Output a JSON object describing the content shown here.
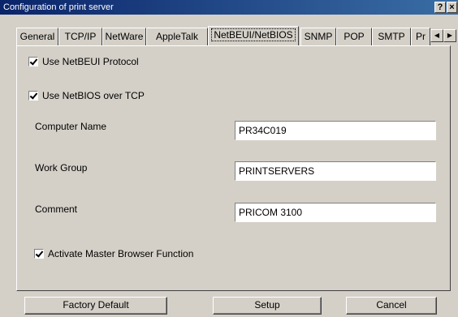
{
  "window": {
    "title": "Configuration of print server",
    "help_glyph": "?",
    "close_glyph": "×"
  },
  "tabs": [
    {
      "label": "General"
    },
    {
      "label": "TCP/IP"
    },
    {
      "label": "NetWare"
    },
    {
      "label": "AppleTalk"
    },
    {
      "label": "NetBEUI/NetBIOS",
      "active": true
    },
    {
      "label": "SNMP"
    },
    {
      "label": "POP"
    },
    {
      "label": "SMTP"
    },
    {
      "label": "Pr"
    }
  ],
  "tab_scroll": {
    "left_glyph": "◀",
    "right_glyph": "▶"
  },
  "panel": {
    "use_netbeui": {
      "label": "Use NetBEUI Protocol",
      "checked": true
    },
    "use_netbios": {
      "label": "Use NetBIOS over TCP",
      "checked": true
    },
    "computer_name": {
      "label": "Computer Name",
      "value": "PR34C019"
    },
    "work_group": {
      "label": "Work Group",
      "value": "PRINTSERVERS"
    },
    "comment": {
      "label": "Comment",
      "value": "PRICOM 3100"
    },
    "master_browser": {
      "label": "Activate Master Browser Function",
      "checked": true
    }
  },
  "buttons": {
    "factory_default": "Factory Default",
    "setup": "Setup",
    "cancel": "Cancel"
  }
}
